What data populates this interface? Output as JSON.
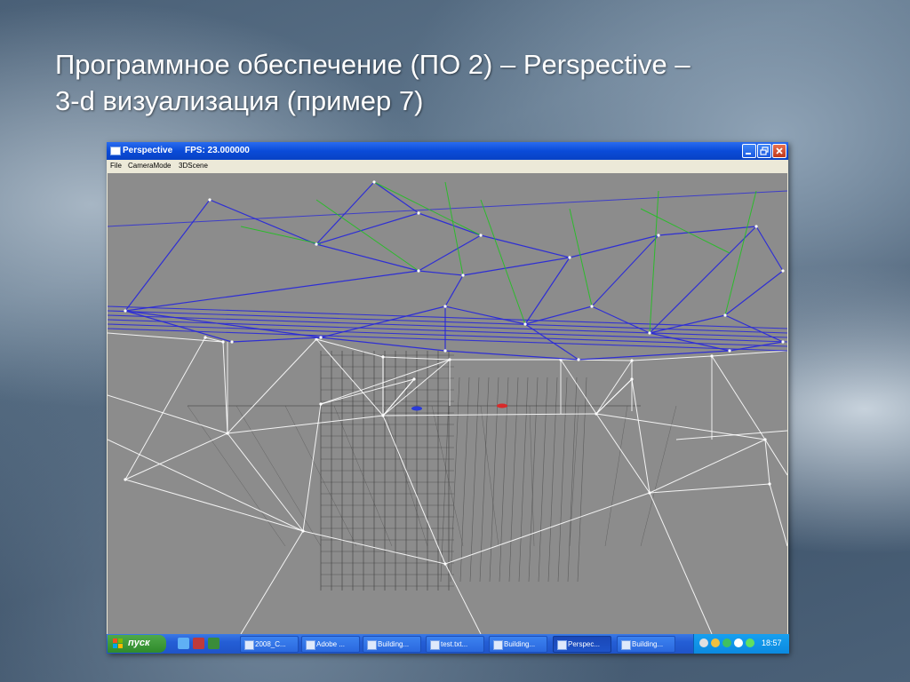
{
  "slide": {
    "title_line1": "Программное обеспечение (ПО 2) – Perspective –",
    "title_line2": "3-d визуализация (пример 7)"
  },
  "window": {
    "title": "Perspective",
    "fps_label": "FPS: 23.000000",
    "menu": [
      "File",
      "CameraMode",
      "3DScene"
    ]
  },
  "taskbar": {
    "start_label": "пуск",
    "tasks": [
      {
        "label": "2008_C...",
        "icon": "folder-icon"
      },
      {
        "label": "Adobe ...",
        "icon": "photoshop-icon"
      },
      {
        "label": "Building...",
        "icon": "document-icon"
      },
      {
        "label": "test.txt...",
        "icon": "document-icon"
      },
      {
        "label": "Building...",
        "icon": "document-icon"
      },
      {
        "label": "Perspec...",
        "icon": "window-icon",
        "active": true
      },
      {
        "label": "Building...",
        "icon": "document-icon"
      }
    ],
    "clock": "18:57"
  },
  "colors": {
    "viewport_bg": "#8c8c8c",
    "mesh_blue": "#2a2ad8",
    "mesh_green": "#22c022",
    "mesh_white": "#ffffff",
    "grid_dark": "#3a3a3a"
  }
}
